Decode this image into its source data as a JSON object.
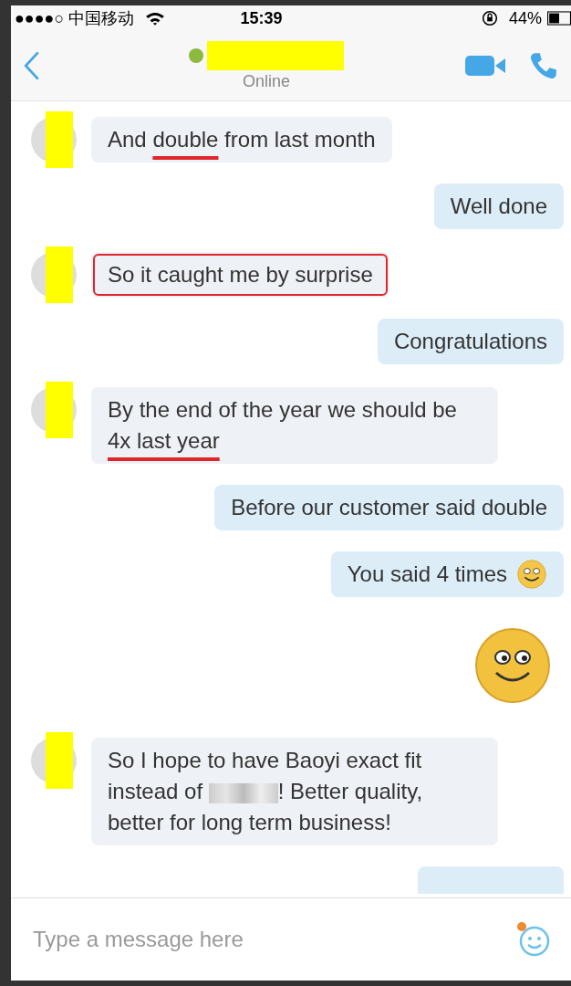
{
  "status_bar": {
    "carrier": "●●●●○ 中国移动",
    "time": "15:39",
    "battery": "44%"
  },
  "header": {
    "online": true,
    "status": "Online"
  },
  "messages": [
    {
      "kind": "incoming",
      "boxed": false,
      "parts": [
        {
          "kind": "text",
          "text": "And "
        },
        {
          "kind": "underlined",
          "text": "double"
        },
        {
          "kind": "text",
          "text": " from last month"
        }
      ]
    },
    {
      "kind": "outgoing",
      "parts": [
        {
          "kind": "text",
          "text": "Well done"
        }
      ]
    },
    {
      "kind": "incoming",
      "boxed": true,
      "parts": [
        {
          "kind": "text",
          "text": "So it caught me by surprise"
        }
      ]
    },
    {
      "kind": "outgoing",
      "parts": [
        {
          "kind": "text",
          "text": "Congratulations"
        }
      ]
    },
    {
      "kind": "incoming",
      "boxed": false,
      "parts": [
        {
          "kind": "text",
          "text": "By the end of the year we should be "
        },
        {
          "kind": "underlined",
          "text": "4x last year"
        }
      ]
    },
    {
      "kind": "outgoing",
      "parts": [
        {
          "kind": "text",
          "text": "Before our customer said double"
        }
      ]
    },
    {
      "kind": "outgoing",
      "smiley": true,
      "parts": [
        {
          "kind": "text",
          "text": "You said 4 times"
        }
      ]
    },
    {
      "kind": "emoticon"
    },
    {
      "kind": "incoming",
      "boxed": false,
      "parts": [
        {
          "kind": "text",
          "text": "So I hope to have Baoyi exact fit instead of "
        },
        {
          "kind": "redacted"
        },
        {
          "kind": "text",
          "text": "! Better quality, better for long term business!"
        }
      ]
    },
    {
      "kind": "partial"
    }
  ],
  "composer": {
    "placeholder": "Type a message here",
    "notification": true
  }
}
